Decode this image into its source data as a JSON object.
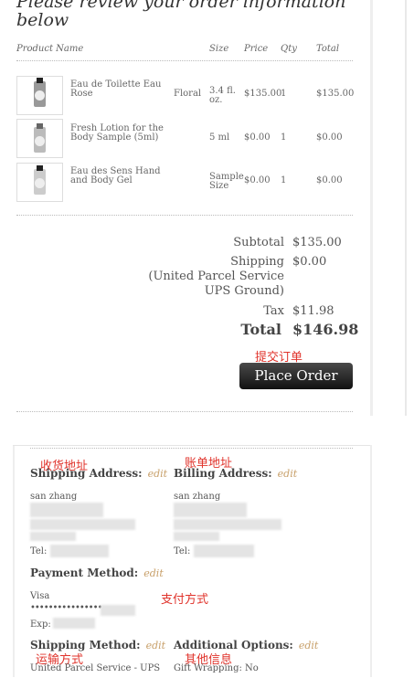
{
  "heading": "Please review your order information below",
  "table": {
    "headers": {
      "product": "Product Name",
      "size": "Size",
      "price": "Price",
      "qty": "Qty",
      "total": "Total"
    },
    "rows": [
      {
        "name": "Eau de Toilette Eau Rose",
        "variant": "Floral",
        "size": "3.4 fl. oz.",
        "price": "$135.00",
        "qty": "1",
        "total": "$135.00"
      },
      {
        "name": "Fresh Lotion for the Body Sample (5ml)",
        "variant": "",
        "size": "5 ml",
        "price": "$0.00",
        "qty": "1",
        "total": "$0.00"
      },
      {
        "name": "Eau des Sens Hand and Body Gel",
        "variant": "",
        "size": "Sample Size",
        "price": "$0.00",
        "qty": "1",
        "total": "$0.00"
      }
    ]
  },
  "totals": {
    "subtotal_label": "Subtotal",
    "subtotal": "$135.00",
    "shipping_label": "Shipping",
    "shipping": "$0.00",
    "shipping_method": "(United Parcel Service UPS Ground)",
    "tax_label": "Tax",
    "tax": "$11.98",
    "total_label": "Total",
    "total": "$146.98"
  },
  "annotations": {
    "submit_order": "提交订单",
    "shipping_address": "收货地址",
    "billing_address": "账单地址",
    "payment_method": "支付方式",
    "shipping_method": "运输方式",
    "other_info": "其他信息"
  },
  "place_order_label": "Place Order",
  "shipping_address": {
    "title": "Shipping Address:",
    "edit": "edit",
    "name": "san zhang",
    "tel_label": "Tel:"
  },
  "billing_address": {
    "title": "Billing Address:",
    "edit": "edit",
    "name": "san zhang",
    "tel_label": "Tel:"
  },
  "payment": {
    "title": "Payment Method:",
    "edit": "edit",
    "card_type": "Visa",
    "card_number": "••••••••••••••••",
    "exp_label": "Exp:"
  },
  "shipping_method": {
    "title": "Shipping Method:",
    "edit": "edit",
    "value": "United Parcel Service - UPS"
  },
  "additional_options": {
    "title": "Additional Options:",
    "edit": "edit",
    "value": "Gift Wrapping: No"
  },
  "colors": {
    "accent_edit": "#c8a06a",
    "annotation_red": "#e0332b",
    "button_dark": "#111111"
  }
}
